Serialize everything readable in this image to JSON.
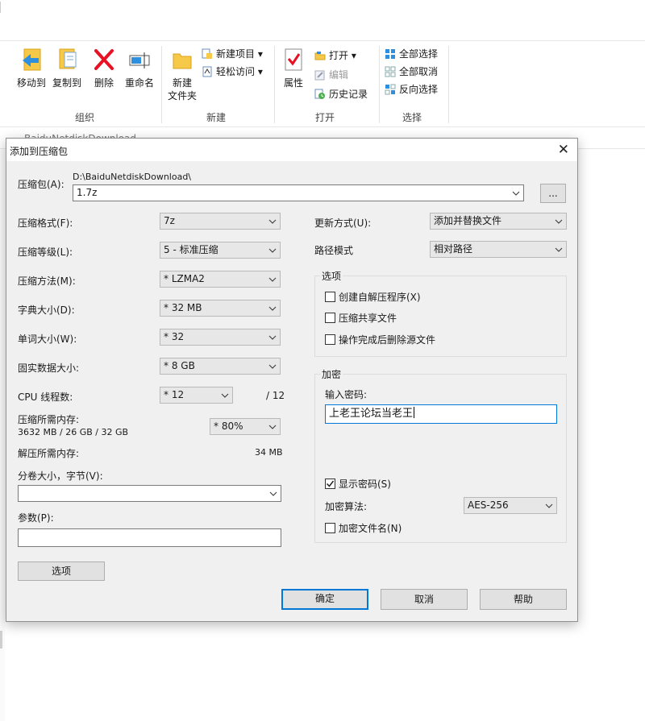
{
  "ribbon": {
    "organize": {
      "label": "组织",
      "move_to": "移动到",
      "copy_to": "复制到",
      "delete": "删除",
      "rename": "重命名"
    },
    "new": {
      "label": "新建",
      "new_folder_line1": "新建",
      "new_folder_line2": "文件夹",
      "new_item": "新建项目",
      "easy_access": "轻松访问"
    },
    "open": {
      "label": "打开",
      "properties": "属性",
      "open": "打开",
      "edit": "编辑",
      "history": "历史记录"
    },
    "select": {
      "label": "选择",
      "select_all": "全部选择",
      "select_none": "全部取消",
      "invert": "反向选择"
    }
  },
  "dialog": {
    "title": "添加到压缩包",
    "archive_label": "压缩包(A):",
    "archive_path": "D:\\BaiduNetdiskDownload\\",
    "archive_name": "1.7z",
    "browse_label": "...",
    "format_label": "压缩格式(F):",
    "format_value": "7z",
    "level_label": "压缩等级(L):",
    "level_value": "5 - 标准压缩",
    "method_label": "压缩方法(M):",
    "method_value": "* LZMA2",
    "dict_label": "字典大小(D):",
    "dict_value": "* 32 MB",
    "word_label": "单词大小(W):",
    "word_value": "* 32",
    "solid_label": "固实数据大小:",
    "solid_value": "* 8 GB",
    "threads_label": "CPU 线程数:",
    "threads_value": "* 12",
    "threads_total": "/ 12",
    "mem_compress_label": "压缩所需内存:",
    "mem_compress_value": "3632 MB / 26 GB / 32 GB",
    "mem_percent": "* 80%",
    "mem_decompress_label": "解压所需内存:",
    "mem_decompress_value": "34 MB",
    "split_label": "分卷大小，字节(V):",
    "split_value": "",
    "params_label": "参数(P):",
    "params_value": "",
    "options_button": "选项",
    "update_label": "更新方式(U):",
    "update_value": "添加并替换文件",
    "path_label": "路径模式",
    "path_value": "相对路径",
    "options_group": {
      "title": "选项",
      "sfx": "创建自解压程序(X)",
      "shared": "压缩共享文件",
      "delete_after": "操作完成后删除源文件"
    },
    "encryption": {
      "title": "加密",
      "password_label": "输入密码:",
      "password_value": "上老王论坛当老王",
      "show_password": "显示密码(S)",
      "method_label": "加密算法:",
      "method_value": "AES-256",
      "encrypt_names": "加密文件名(N)"
    },
    "ok": "确定",
    "cancel": "取消",
    "help": "帮助"
  },
  "background": {
    "breadcrumb_fragment": "BaiduNetdiskDownload"
  },
  "colors": {
    "accent": "#0078d7",
    "delete_red": "#e81123",
    "folder_yellow": "#f7c948"
  }
}
